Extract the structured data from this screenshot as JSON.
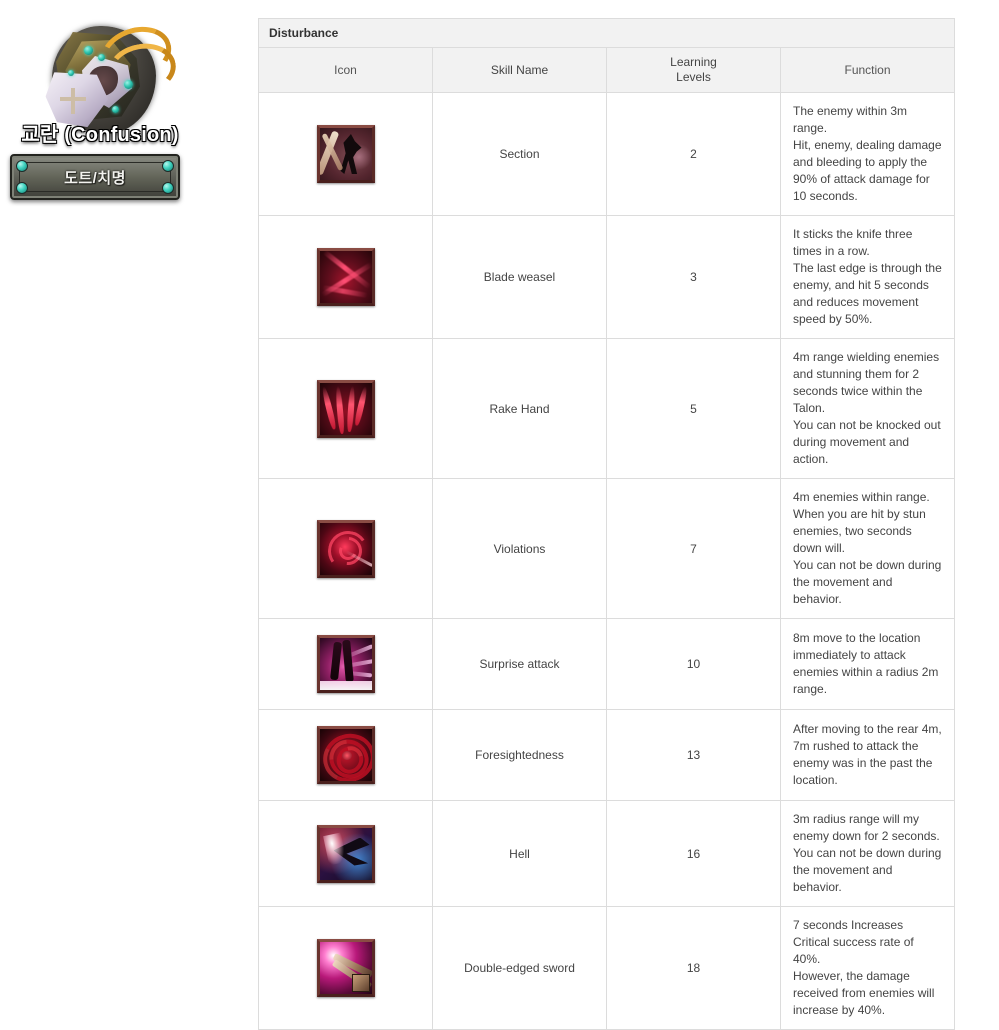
{
  "emblem": {
    "title": "교란 (Confusion)",
    "banner_label": "도트/치명",
    "icon_name": "confusion-class-emblem"
  },
  "table": {
    "caption": "Disturbance",
    "columns": [
      {
        "key": "icon",
        "label": "Icon"
      },
      {
        "key": "name",
        "label": "Skill Name"
      },
      {
        "key": "level",
        "label": "Learning\nLevels"
      },
      {
        "key": "function",
        "label": "Function"
      }
    ],
    "rows": [
      {
        "icon": "skill-icon-section",
        "name": "Section",
        "level": "2",
        "function": "The enemy within 3m range.\nHit, enemy, dealing damage and bleeding to apply the 90% of attack damage for 10 seconds."
      },
      {
        "icon": "skill-icon-blade-weasel",
        "name": "Blade weasel",
        "level": "3",
        "function": "It sticks the knife three times in a row.\nThe last edge is through the enemy, and hit 5 seconds and reduces movement speed by 50%."
      },
      {
        "icon": "skill-icon-rake-hand",
        "name": "Rake Hand",
        "level": "5",
        "function": "4m range wielding enemies and stunning them for 2 seconds twice within the Talon.\nYou can not be knocked out during movement and action."
      },
      {
        "icon": "skill-icon-violations",
        "name": "Violations",
        "level": "7",
        "function": "4m enemies within range.\nWhen you are hit by stun enemies, two seconds down will.\nYou can not be down during the movement and behavior."
      },
      {
        "icon": "skill-icon-surprise-attack",
        "name": "Surprise attack",
        "level": "10",
        "function": "8m move to the location immediately to attack enemies within a radius 2m range."
      },
      {
        "icon": "skill-icon-foresightedness",
        "name": "Foresightedness",
        "level": "13",
        "function": "After moving to the rear 4m, 7m rushed to attack the enemy was in the past the location."
      },
      {
        "icon": "skill-icon-hell",
        "name": "Hell",
        "level": "16",
        "function": "3m radius range will my enemy down for 2 seconds.\nYou can not be down during the movement and behavior."
      },
      {
        "icon": "skill-icon-double-edged-sword",
        "name": "Double-edged sword",
        "level": "18",
        "function": "7 seconds Increases Critical success rate of 40%.\nHowever, the damage received from enemies will increase by 40%."
      }
    ]
  },
  "colors": {
    "header_bg": "#f2f2f2",
    "border": "#dcdcdc",
    "text": "#444444",
    "gem_accent": "#2ec6b0",
    "page_bg": "#ffffff"
  }
}
